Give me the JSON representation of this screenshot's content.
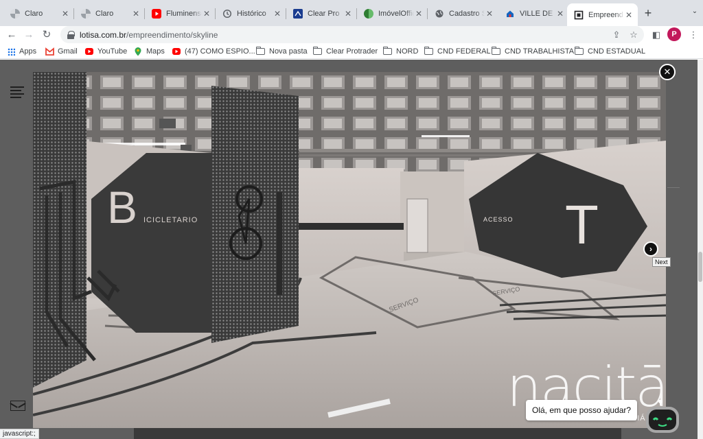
{
  "tabs": [
    {
      "title": "Claro",
      "icon": "spinner-icon",
      "color": "#9aa0a6"
    },
    {
      "title": "Claro",
      "icon": "spinner-icon",
      "color": "#9aa0a6"
    },
    {
      "title": "Fluminense",
      "icon": "youtube-icon",
      "color": "#ff0000"
    },
    {
      "title": "Histórico",
      "icon": "history-icon",
      "color": "#5f6368"
    },
    {
      "title": "Clear Pro",
      "icon": "clear-logo-icon",
      "color": "#1a3c8f"
    },
    {
      "title": "ImóvelOffice",
      "icon": "imoveloffice-icon",
      "color": "#2e7d32"
    },
    {
      "title": "Cadastro S",
      "icon": "globe-icon",
      "color": "#5f6368"
    },
    {
      "title": "VILLE DE L",
      "icon": "house-icon",
      "color": "#1565c0"
    },
    {
      "title": "Empreendi",
      "icon": "site-logo-icon",
      "color": "#202124",
      "active": true
    }
  ],
  "url": {
    "host": "lotisa.com.br",
    "path": "/empreendimento/skyline"
  },
  "bookmarks": [
    {
      "label": "Apps",
      "type": "apps"
    },
    {
      "label": "Gmail",
      "type": "gmail"
    },
    {
      "label": "YouTube",
      "type": "youtube"
    },
    {
      "label": "Maps",
      "type": "maps"
    },
    {
      "label": "(47) COMO ESPIO...",
      "type": "youtube"
    },
    {
      "label": "Nova pasta",
      "type": "folder"
    },
    {
      "label": "Clear Protrader",
      "type": "folder"
    },
    {
      "label": "NORD",
      "type": "folder"
    },
    {
      "label": "CND FEDERAL",
      "type": "folder"
    },
    {
      "label": "CND TRABALHISTA",
      "type": "folder"
    },
    {
      "label": "CND ESTADUAL",
      "type": "folder"
    }
  ],
  "profile_initial": "P",
  "image": {
    "sign_b_letter": "B",
    "sign_b_text": "ICICLETARIO",
    "sign_t_letter": "T",
    "sign_t_text": "ACESSO",
    "floor_text_1": "SERVIÇO",
    "floor_text_2": "SERVIÇO"
  },
  "lightbox": {
    "next_tooltip": "Next"
  },
  "brand": {
    "word": "nacitā",
    "sub": "CONSULTORIA IMOBILIÁRIA"
  },
  "chat": {
    "message": "Olá, em que posso ajudar?"
  },
  "status_bar": "javascript:;"
}
